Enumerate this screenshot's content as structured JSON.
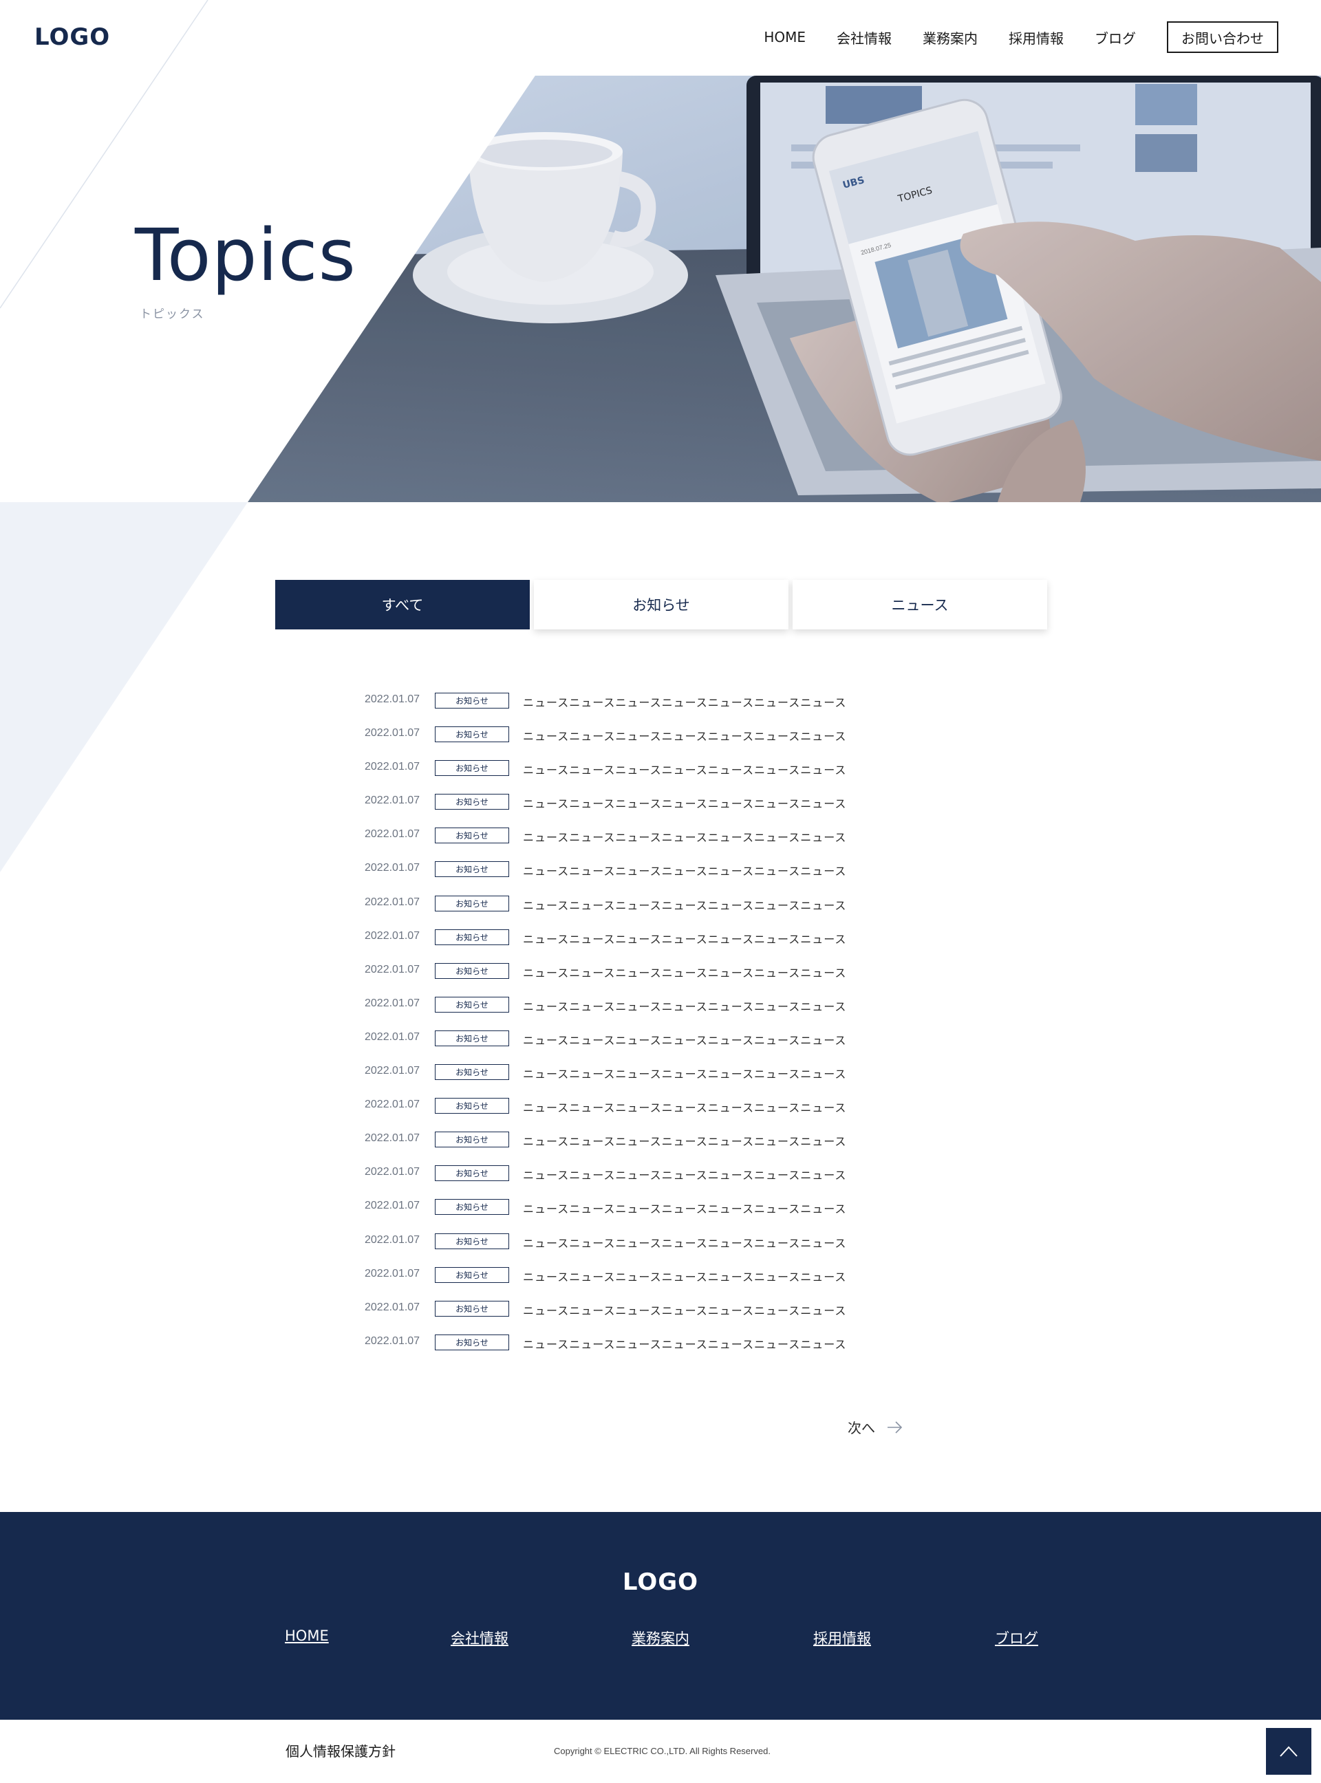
{
  "header": {
    "logo": "LOGO",
    "nav": [
      "HOME",
      "会社情報",
      "業務案内",
      "採用情報",
      "ブログ"
    ],
    "contact": "お問い合わせ"
  },
  "hero": {
    "title": "Topics",
    "subtitle": "トピックス",
    "photo_screen_logo": "UBS",
    "photo_screen_heading": "TOPICS",
    "photo_screen_date": "2018.07.25"
  },
  "tabs": [
    "すべて",
    "お知らせ",
    "ニュース"
  ],
  "news": [
    {
      "date": "2022.01.07",
      "category": "お知らせ",
      "title": "ニュースニュースニュースニュースニュースニュースニュース"
    },
    {
      "date": "2022.01.07",
      "category": "お知らせ",
      "title": "ニュースニュースニュースニュースニュースニュースニュース"
    },
    {
      "date": "2022.01.07",
      "category": "お知らせ",
      "title": "ニュースニュースニュースニュースニュースニュースニュース"
    },
    {
      "date": "2022.01.07",
      "category": "お知らせ",
      "title": "ニュースニュースニュースニュースニュースニュースニュース"
    },
    {
      "date": "2022.01.07",
      "category": "お知らせ",
      "title": "ニュースニュースニュースニュースニュースニュースニュース"
    },
    {
      "date": "2022.01.07",
      "category": "お知らせ",
      "title": "ニュースニュースニュースニュースニュースニュースニュース"
    },
    {
      "date": "2022.01.07",
      "category": "お知らせ",
      "title": "ニュースニュースニュースニュースニュースニュースニュース"
    },
    {
      "date": "2022.01.07",
      "category": "お知らせ",
      "title": "ニュースニュースニュースニュースニュースニュースニュース"
    },
    {
      "date": "2022.01.07",
      "category": "お知らせ",
      "title": "ニュースニュースニュースニュースニュースニュースニュース"
    },
    {
      "date": "2022.01.07",
      "category": "お知らせ",
      "title": "ニュースニュースニュースニュースニュースニュースニュース"
    },
    {
      "date": "2022.01.07",
      "category": "お知らせ",
      "title": "ニュースニュースニュースニュースニュースニュースニュース"
    },
    {
      "date": "2022.01.07",
      "category": "お知らせ",
      "title": "ニュースニュースニュースニュースニュースニュースニュース"
    },
    {
      "date": "2022.01.07",
      "category": "お知らせ",
      "title": "ニュースニュースニュースニュースニュースニュースニュース"
    },
    {
      "date": "2022.01.07",
      "category": "お知らせ",
      "title": "ニュースニュースニュースニュースニュースニュースニュース"
    },
    {
      "date": "2022.01.07",
      "category": "お知らせ",
      "title": "ニュースニュースニュースニュースニュースニュースニュース"
    },
    {
      "date": "2022.01.07",
      "category": "お知らせ",
      "title": "ニュースニュースニュースニュースニュースニュースニュース"
    },
    {
      "date": "2022.01.07",
      "category": "お知らせ",
      "title": "ニュースニュースニュースニュースニュースニュースニュース"
    },
    {
      "date": "2022.01.07",
      "category": "お知らせ",
      "title": "ニュースニュースニュースニュースニュースニュースニュース"
    },
    {
      "date": "2022.01.07",
      "category": "お知らせ",
      "title": "ニュースニュースニュースニュースニュースニュースニュース"
    },
    {
      "date": "2022.01.07",
      "category": "お知らせ",
      "title": "ニュースニュースニュースニュースニュースニュースニュース"
    }
  ],
  "pagination": {
    "next": "次へ"
  },
  "footer": {
    "logo": "LOGO",
    "nav": [
      "HOME",
      "会社情報",
      "業務案内",
      "採用情報",
      "ブログ"
    ],
    "privacy": "個人情報保護方針",
    "copyright": "Copyright © ELECTRIC CO.,LTD. All Rights Reserved."
  },
  "colors": {
    "primary": "#16294d",
    "tint": "#eef2f8",
    "white": "#ffffff"
  },
  "icons": [
    "arrow-right-icon",
    "chevron-up-icon"
  ]
}
